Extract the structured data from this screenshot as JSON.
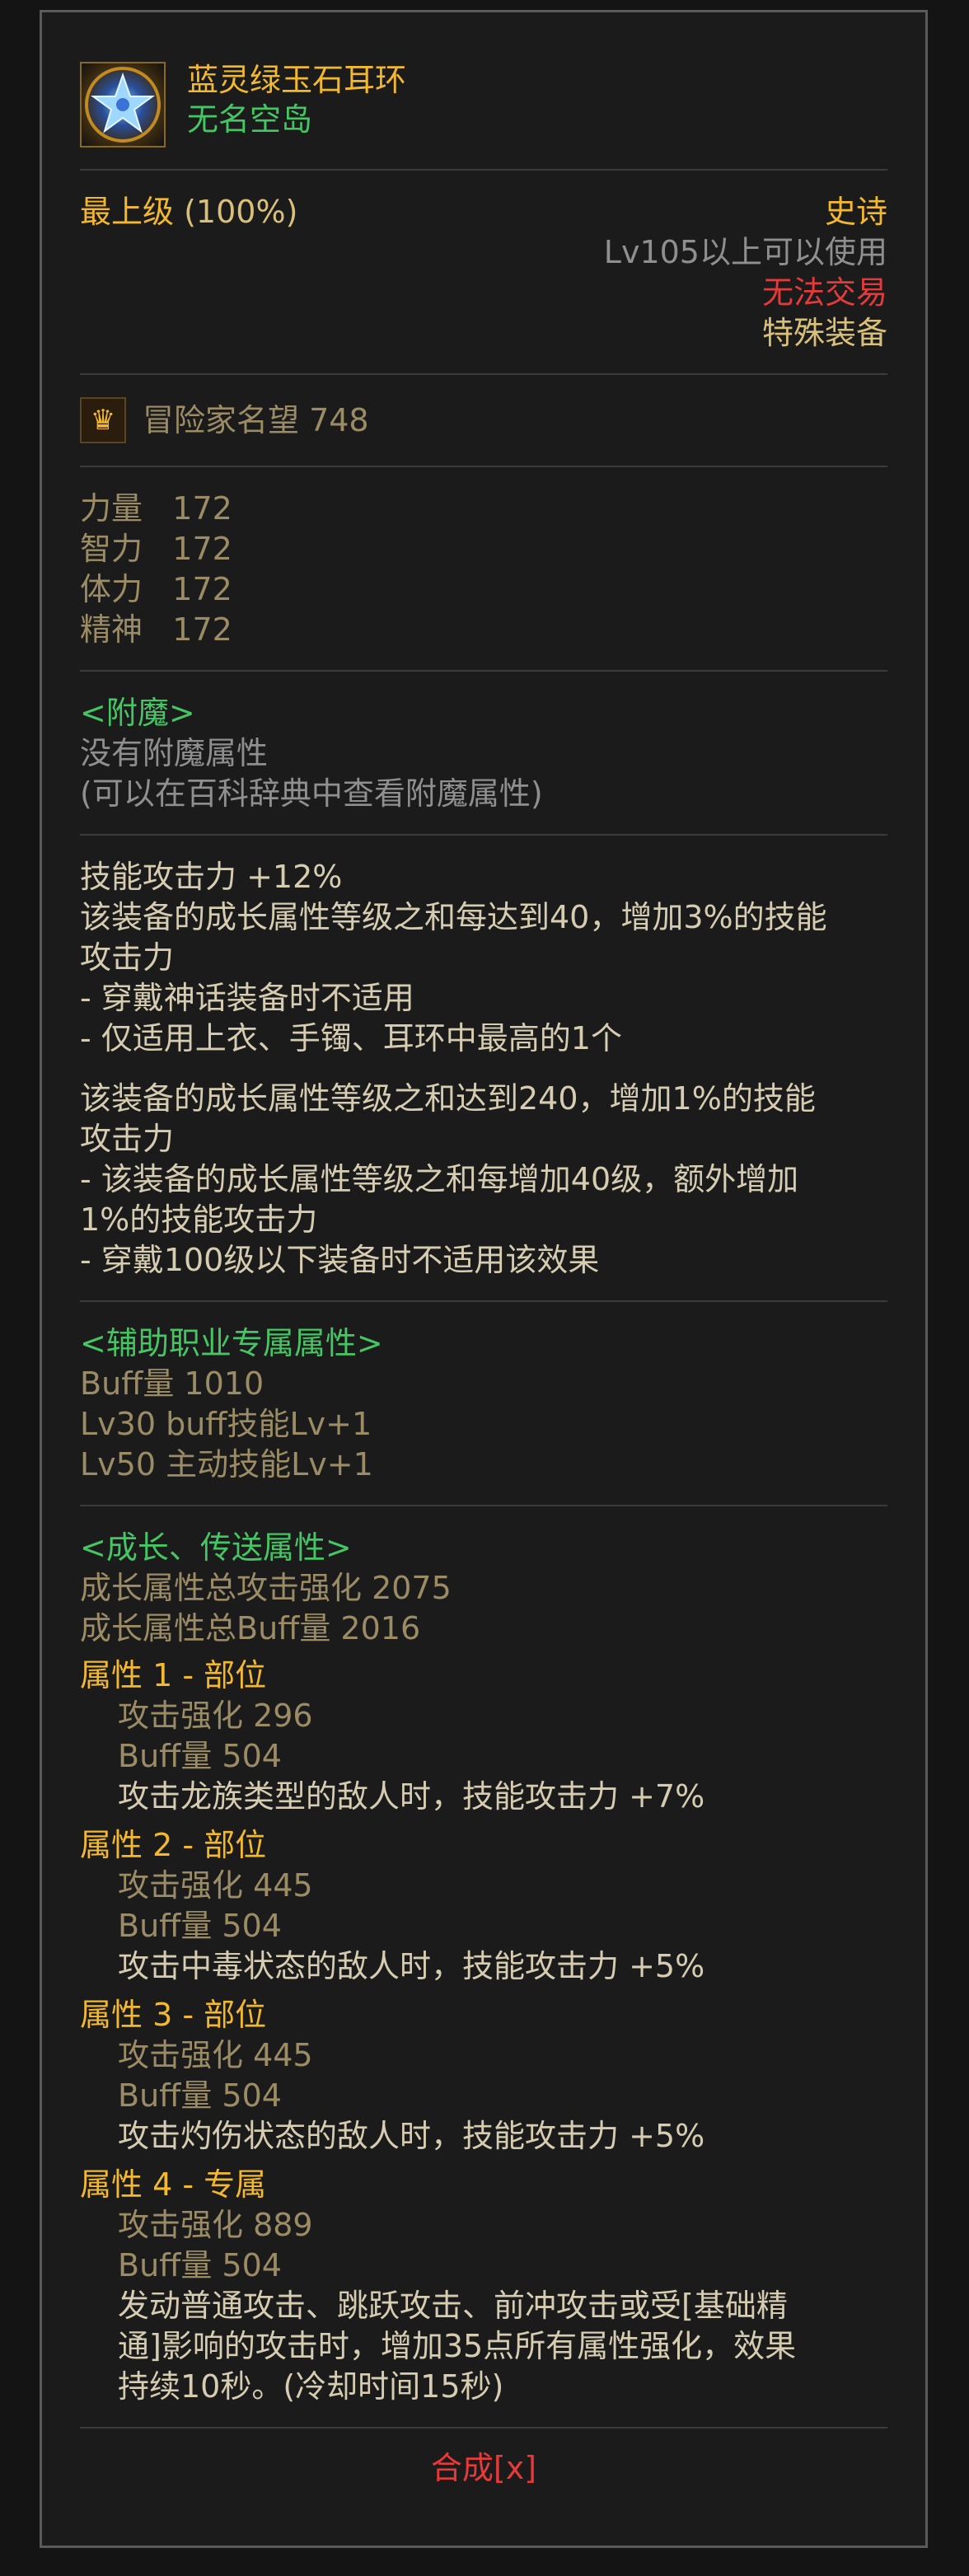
{
  "item": {
    "name": "蓝灵绿玉石耳环",
    "set_name": "无名空岛",
    "icon": "blue-star-earring-icon"
  },
  "grade": {
    "label": "最上级",
    "percent": "(100%)",
    "rarity": "史诗",
    "level_req": "Lv105以上可以使用",
    "trade": "无法交易",
    "type": "特殊装备"
  },
  "fame": {
    "icon": "crown-icon",
    "text": "冒险家名望 748"
  },
  "stats": [
    {
      "name": "力量",
      "value": "172"
    },
    {
      "name": "智力",
      "value": "172"
    },
    {
      "name": "体力",
      "value": "172"
    },
    {
      "name": "精神",
      "value": "172"
    }
  ],
  "enchant": {
    "header": "<附魔>",
    "none": "没有附魔属性",
    "hint": "(可以在百科辞典中查看附魔属性)"
  },
  "skill": {
    "line1": "技能攻击力  +12%",
    "line2": "该装备的成长属性等级之和每达到40，增加3%的技能",
    "line3": "攻击力",
    "line4": "- 穿戴神话装备时不适用",
    "line5": "- 仅适用上衣、手镯、耳环中最高的1个",
    "line6": "该装备的成长属性等级之和达到240，增加1%的技能",
    "line7": "攻击力",
    "line8": "- 该装备的成长属性等级之和每增加40级，额外增加",
    "line9": "1%的技能攻击力",
    "line10": "- 穿戴100级以下装备时不适用该效果"
  },
  "support": {
    "header": "<辅助职业专属属性>",
    "buff": "Buff量   1010",
    "lv30": "Lv30 buff技能Lv+1",
    "lv50": "Lv50 主动技能Lv+1"
  },
  "growth": {
    "header": "<成长、传送属性>",
    "total_atk": "成长属性总攻击强化 2075",
    "total_buff": "成长属性总Buff量 2016",
    "attrs": [
      {
        "title": "属性 1 - 部位",
        "atk": "攻击强化   296",
        "buff": "Buff量   504",
        "effect": "攻击龙族类型的敌人时，技能攻击力 +7%"
      },
      {
        "title": "属性 2 - 部位",
        "atk": "攻击强化   445",
        "buff": "Buff量   504",
        "effect": "攻击中毒状态的敌人时，技能攻击力 +5%"
      },
      {
        "title": "属性 3 - 部位",
        "atk": "攻击强化   445",
        "buff": "Buff量   504",
        "effect": "攻击灼伤状态的敌人时，技能攻击力 +5%"
      },
      {
        "title": "属性 4 - 专属",
        "atk": "攻击强化   889",
        "buff": "Buff量   504",
        "effect1": "发动普通攻击、跳跃攻击、前冲攻击或受[基础精",
        "effect2": "通]影响的攻击时，增加35点所有属性强化，效果",
        "effect3": "持续10秒。(冷却时间15秒)"
      }
    ]
  },
  "footer": {
    "synth": "合成[x]"
  },
  "colors": {
    "gold": "#f2b830",
    "green": "#46c565",
    "red": "#e33b3b",
    "gray": "#8f8f8f"
  }
}
